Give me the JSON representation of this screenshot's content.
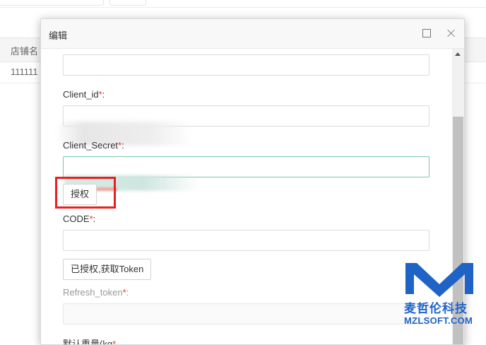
{
  "background": {
    "table_header_col1": "店铺名",
    "table_row_col1": "111111"
  },
  "modal": {
    "title": "编辑",
    "fields": {
      "client_id": {
        "label": "Client_id",
        "required_mark": "*",
        "colon": ":"
      },
      "client_secret": {
        "label": "Client_Secret",
        "required_mark": "*",
        "colon": ":"
      },
      "code": {
        "label": "CODE",
        "required_mark": "*",
        "colon": ":",
        "value": ""
      },
      "refresh_token": {
        "label": "Refresh_token",
        "required_mark": "*",
        "colon": ":",
        "value": ""
      },
      "next": {
        "label": "默认重量(kg",
        "required_mark": "*"
      }
    },
    "buttons": {
      "authorize": "授权",
      "get_token": "已授权,获取Token"
    }
  },
  "watermark": {
    "cn": "麦哲伦科技",
    "en": "MZLSOFT.COM",
    "color": "#1f63c7"
  },
  "colors": {
    "highlight": "#e8201f",
    "required": "#e33"
  }
}
